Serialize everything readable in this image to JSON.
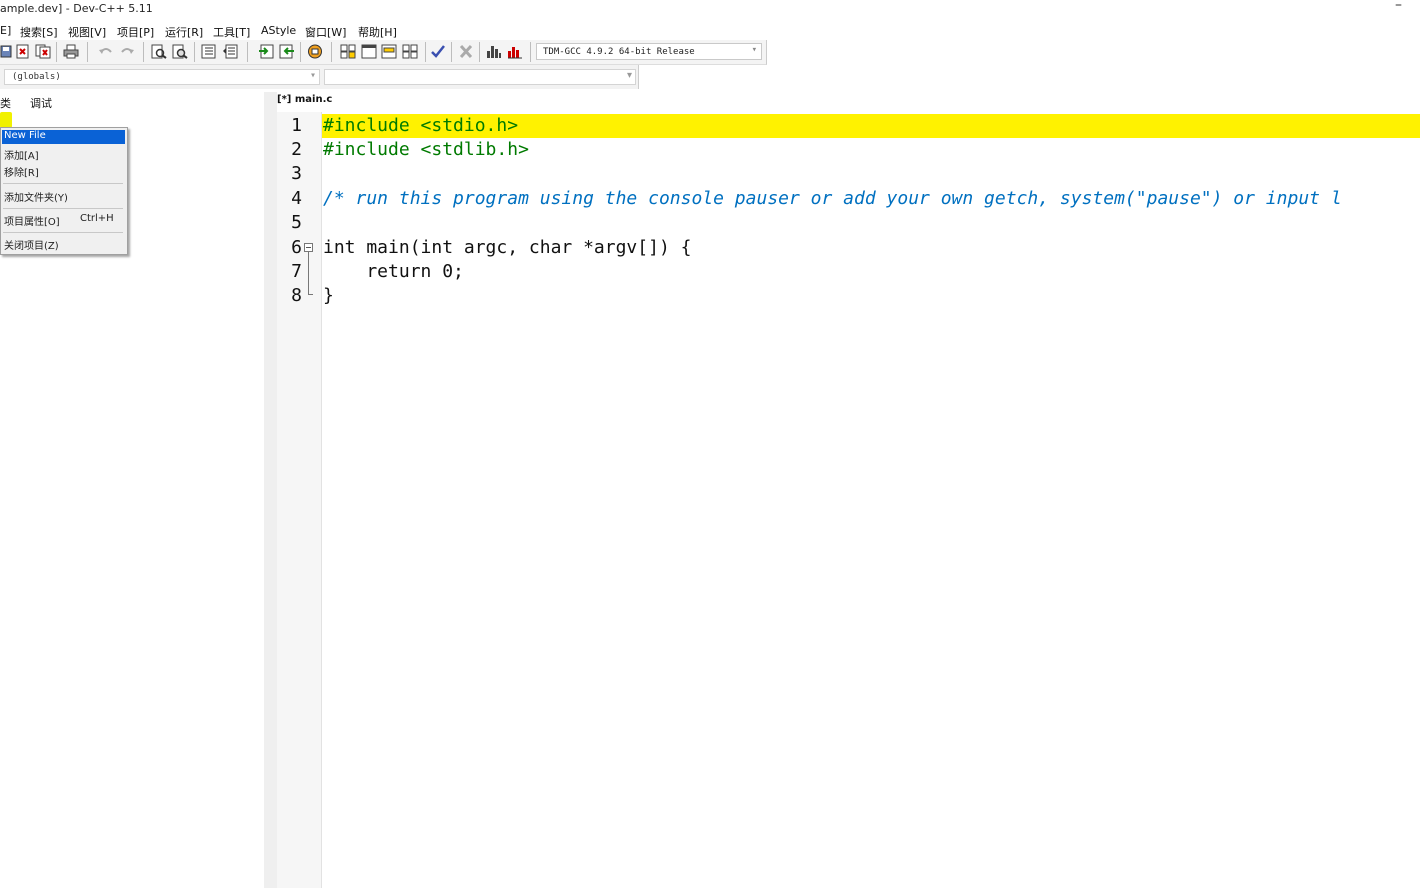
{
  "window": {
    "title": "ample.dev] - Dev-C++ 5.11",
    "minimize": "–"
  },
  "menu": [
    "E]",
    "搜索[S]",
    "视图[V]",
    "项目[P]",
    "运行[R]",
    "工具[T]",
    "AStyle",
    "窗口[W]",
    "帮助[H]"
  ],
  "toolbar": {
    "compiler": "TDM-GCC 4.9.2 64-bit Release",
    "dropdown_arrow": "▾"
  },
  "classbar": {
    "scope": "(globals)",
    "function": ""
  },
  "left_tabs": [
    "类",
    "调试"
  ],
  "context_menu": {
    "items": [
      {
        "label": "New File",
        "selected": true
      },
      {
        "label": "添加[A]"
      },
      {
        "label": "移除[R]"
      },
      {
        "label": "添加文件夹(Y)"
      },
      {
        "label": "项目属性[O]",
        "shortcut": "Ctrl+H"
      },
      {
        "label": "关闭项目(Z)"
      }
    ]
  },
  "editor": {
    "tab": "[*] main.c",
    "line_numbers": [
      "1",
      "2",
      "3",
      "4",
      "5",
      "6",
      "7",
      "8"
    ],
    "lines": [
      "#include <stdio.h>",
      "#include <stdlib.h>",
      "",
      "/* run this program using the console pauser or add your own getch, system(\"pause\") or input l",
      "",
      "int main(int argc, char *argv[]) {",
      "    return 0;",
      "}"
    ]
  },
  "colors": {
    "highlight": "#fff200",
    "preprocessor": "#007a00",
    "comment": "#0070c0",
    "selection": "#0a62d6"
  },
  "icons": [
    "save-all-icon",
    "close-icon",
    "close-all-icon",
    "print-icon",
    "undo-icon",
    "redo-icon",
    "find-icon",
    "replace-icon",
    "indent-icon",
    "unindent-icon",
    "goto-icon",
    "bookmark-icon",
    "compile-icon",
    "run-icon",
    "compile-run-icon",
    "rebuild-icon",
    "check-icon",
    "stop-icon",
    "chart-icon",
    "profile-icon"
  ]
}
